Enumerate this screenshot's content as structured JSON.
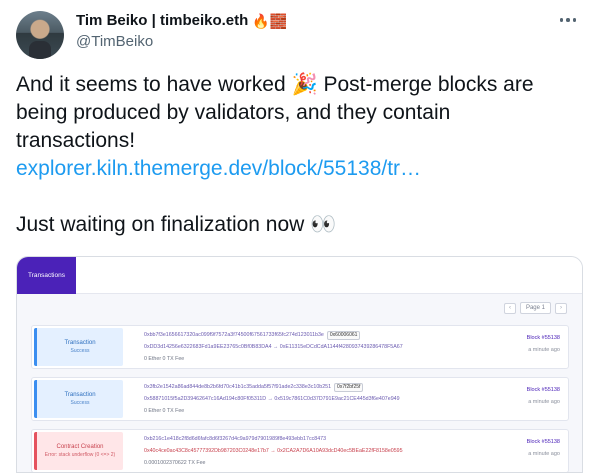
{
  "author": {
    "name": "Tim Beiko | timbeiko.eth",
    "emoji": "🔥🧱",
    "handle": "@TimBeiko"
  },
  "tweet": {
    "line1": "And it seems to have worked 🎉 Post-merge blocks are",
    "line2": "being produced by validators, and they contain",
    "line3": "transactions!",
    "link": "explorer.kiln.themerge.dev/block/55138/tr…",
    "line5": "Just waiting on finalization now 👀"
  },
  "explorer": {
    "tab_label": "Transactions",
    "pager": {
      "prev": "‹",
      "label": "Page 1",
      "next": "›"
    },
    "rows": [
      {
        "status": "Transaction",
        "status_sub": "Success",
        "hash": "0xbb7f3e1656617320ac099f9f7572a3f74500f67561733f65fc274d123011b3e",
        "pill": "0x60006061",
        "from_to": "0xDD3d14256e6322683Fd1a9EE23765c0Bf0B83DA4 → 0xE11315eDCdCdA1144f4280937439286478F5A67",
        "fee": "0 Ether  0 TX Fee",
        "block": "Block #55138",
        "ago": "a minute ago"
      },
      {
        "status": "Transaction",
        "status_sub": "Success",
        "hash": "0x3fb2e1542a86ad844de8b2b6fd70c41b1c35adda5f57f91ade2c338e3c10b251",
        "pill": "0x7f2bf25f",
        "from_to": "0x58871015f5a2D39462647c16Ad194c80Ff05311D → 0x519c7861C0d37D791E9ac21CE445d3f6e407e949",
        "fee": "0 Ether  0 TX Fee",
        "block": "Block #55138",
        "ago": "a minute ago"
      },
      {
        "status": "Contract Creation",
        "status_sub": "Error: stack underflow (0 <=> 2)",
        "hash": "0xb216c1e418c2f8d6d6fafc8d6f3267d4c9a979d7901989f8e493ebb17cc8473",
        "pill": "",
        "from_to": "0x40c4ce0ac43C8c45777392Db987203C0248e17b7 → 0x2CA2A7D6A10A93dcD40ec5BEaE22fF8158e0595",
        "fee": "0.0001002370622 TX Fee",
        "block": "Block #55138",
        "ago": "a minute ago"
      }
    ]
  }
}
